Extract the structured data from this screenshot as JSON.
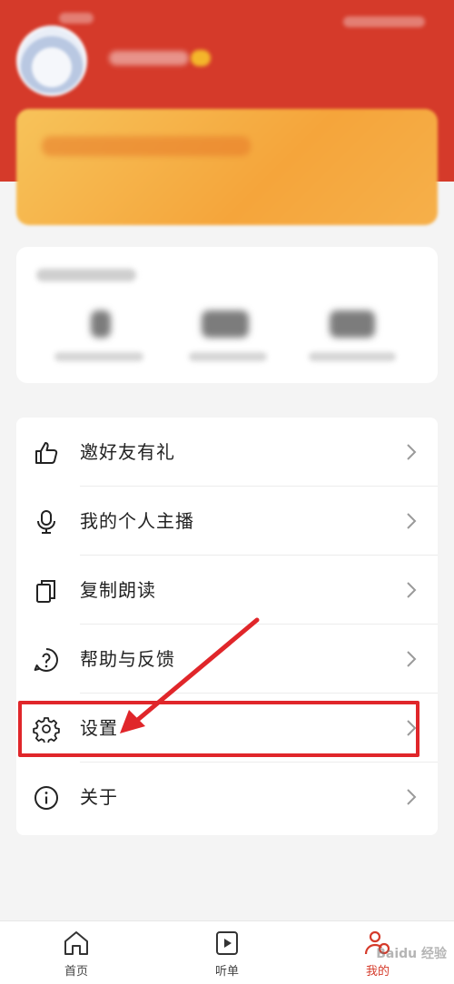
{
  "menu": {
    "items": [
      {
        "label": "邀好友有礼",
        "icon": "thumbs-up-icon"
      },
      {
        "label": "我的个人主播",
        "icon": "microphone-icon"
      },
      {
        "label": "复制朗读",
        "icon": "copy-icon"
      },
      {
        "label": "帮助与反馈",
        "icon": "help-icon"
      },
      {
        "label": "设置",
        "icon": "gear-icon"
      },
      {
        "label": "关于",
        "icon": "info-icon"
      }
    ]
  },
  "tabbar": {
    "tabs": [
      {
        "label": "首页",
        "icon": "home-icon"
      },
      {
        "label": "听单",
        "icon": "playlist-icon"
      },
      {
        "label": "我的",
        "icon": "profile-icon"
      }
    ]
  },
  "watermark": "Baidu 经验",
  "colors": {
    "header": "#d53a2a",
    "vip_card": "#f5a53b",
    "highlight": "#e0262a",
    "active_tab": "#d53a2a"
  }
}
